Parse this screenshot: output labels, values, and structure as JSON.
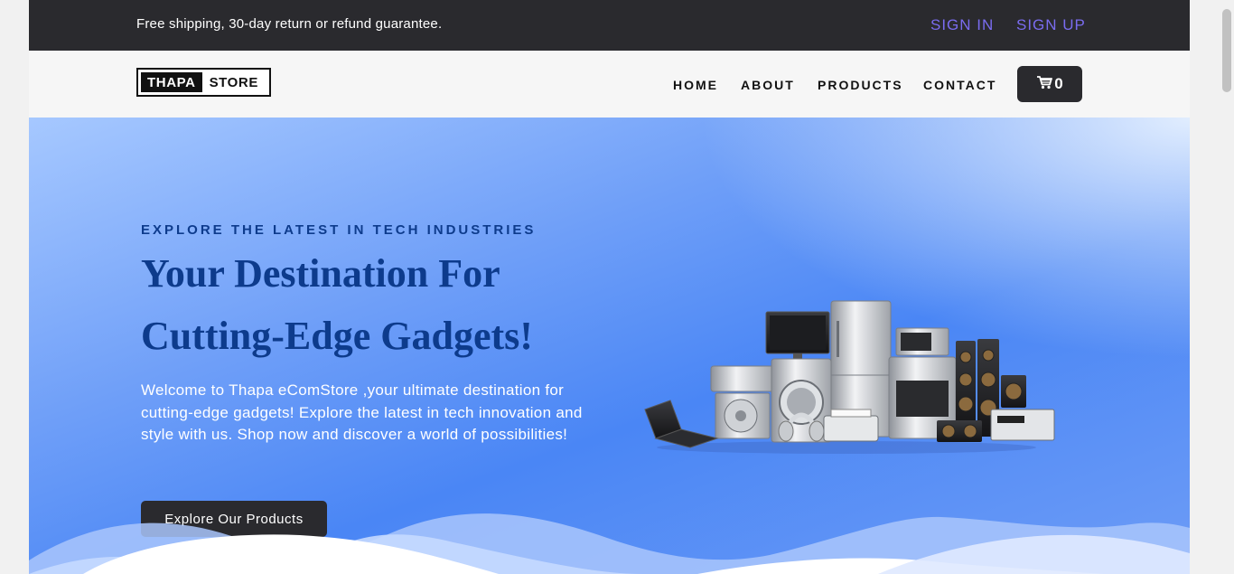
{
  "topbar": {
    "promo": "Free shipping, 30-day return or refund guarantee.",
    "sign_in": "SIGN IN",
    "sign_up": "SIGN UP"
  },
  "navbar": {
    "logo_part1": "THAPA",
    "logo_part2": "STORE",
    "links": [
      "HOME",
      "ABOUT",
      "PRODUCTS",
      "CONTACT"
    ],
    "cart_icon": "cart-icon",
    "cart_count": "0"
  },
  "hero": {
    "eyebrow": "EXPLORE THE LATEST IN TECH INDUSTRIES",
    "headline": "Your Destination For Cutting-Edge Gadgets!",
    "intro": "Welcome to Thapa eComStore ,your ultimate destination for cutting-edge gadgets! Explore the latest in tech innovation and style with us. Shop now and discover a world of possibilities!",
    "button": "Explore Our Products"
  },
  "colors": {
    "dark": "#2a2a2e",
    "auth_link": "#7a6cf0",
    "heading_blue": "#0d3b8c",
    "hero_blue": "#4a86f5"
  }
}
